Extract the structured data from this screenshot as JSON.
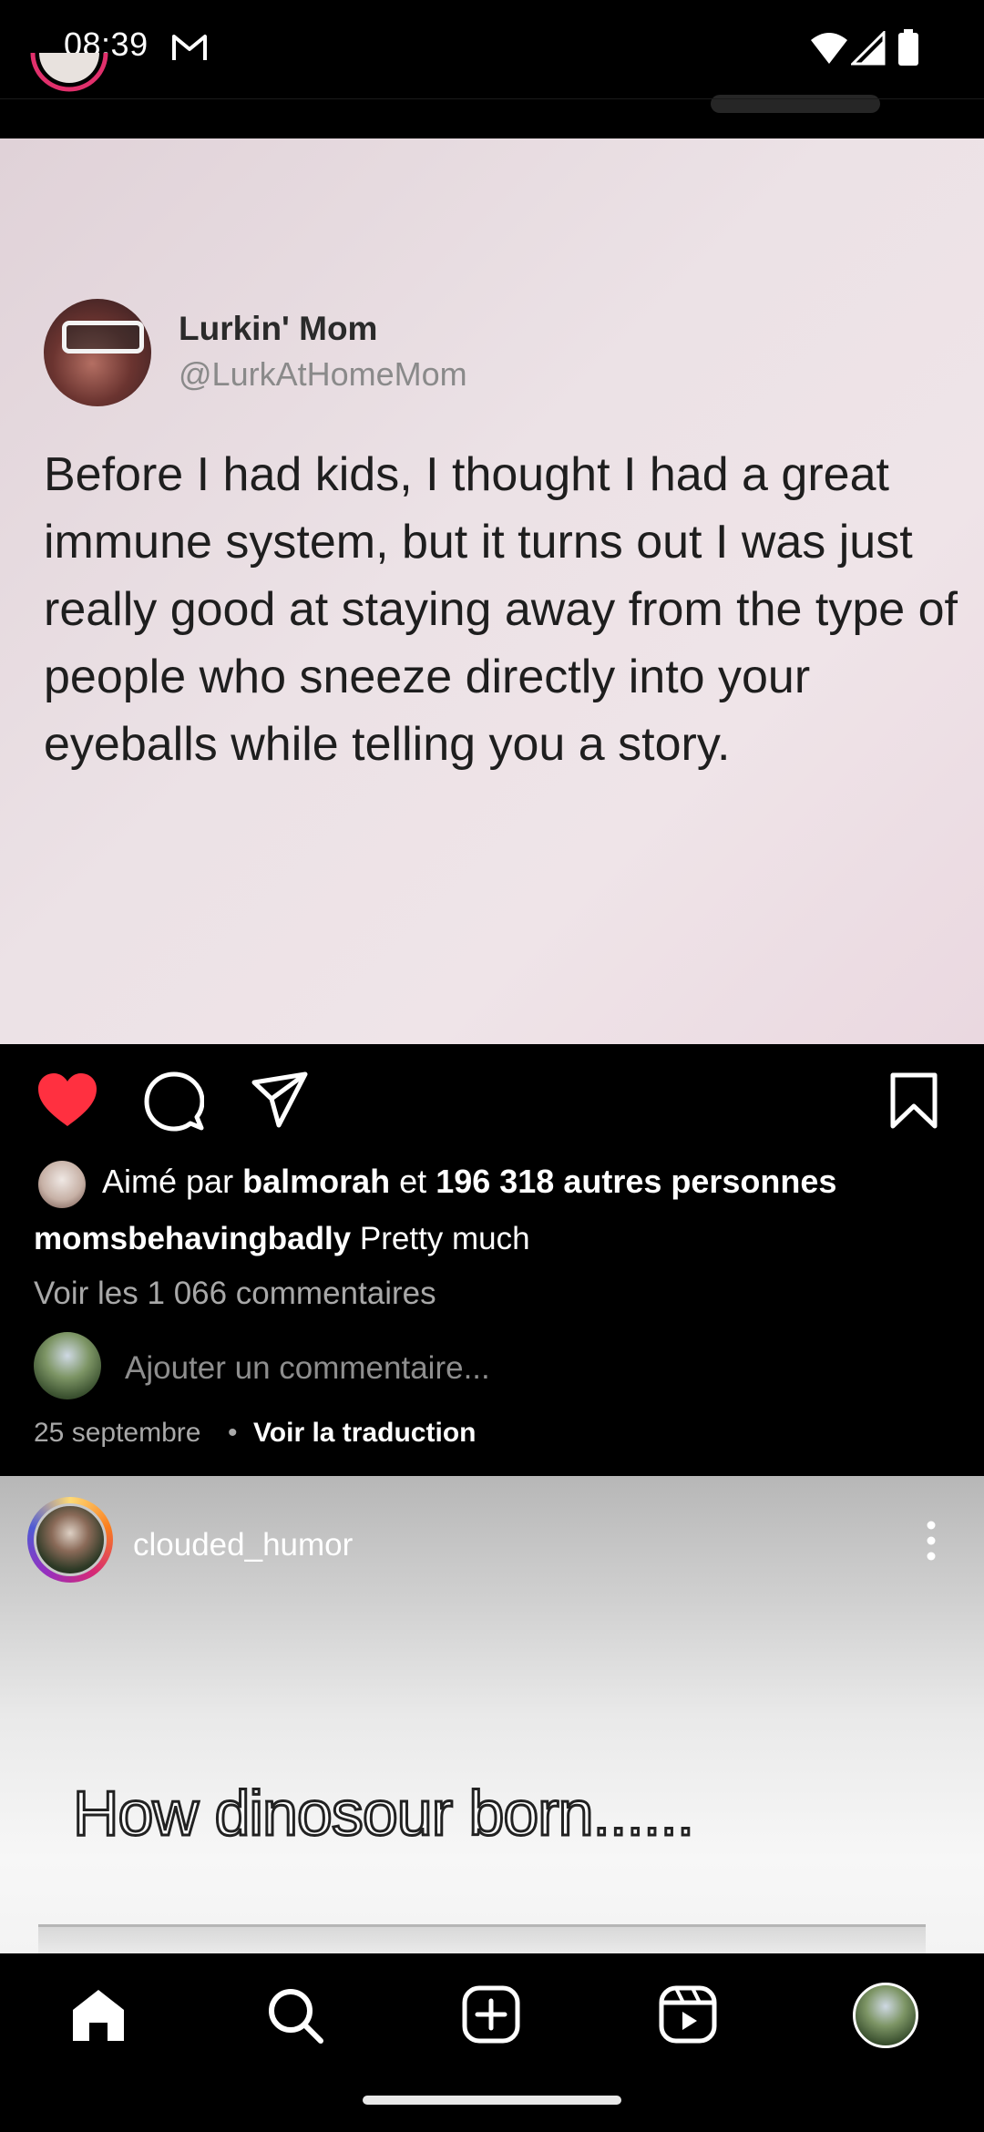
{
  "status_bar": {
    "time": "08:39"
  },
  "post1": {
    "tweet": {
      "name": "Lurkin' Mom",
      "handle": "@LurkAtHomeMom",
      "text": "Before I had kids, I thought I had a great immune system, but it turns out I was just really good at staying away from the type of people who sneeze directly into your eyeballs while telling you a story."
    },
    "likes": {
      "prefix": "Aimé par",
      "user": "balmorah",
      "connector": "et",
      "others": "196 318 autres personnes"
    },
    "caption": {
      "username": "momsbehavingbadly",
      "text": "Pretty much"
    },
    "view_comments": "Voir les 1 066 commentaires",
    "add_comment_placeholder": "Ajouter un commentaire...",
    "date": "25 septembre",
    "separator": "•",
    "translate_link": "Voir la traduction",
    "liked": true
  },
  "post2": {
    "username": "clouded_humor",
    "meme_text": "How dinosour born......"
  },
  "colors": {
    "like_red": "#ff3040",
    "background": "#000000",
    "secondary_text": "#a8a8a8"
  },
  "icons": {
    "status": [
      "gmail-icon",
      "wifi-icon",
      "signal-icon",
      "battery-icon"
    ],
    "actions": [
      "heart-icon",
      "comment-icon",
      "share-icon",
      "bookmark-icon"
    ],
    "nav": [
      "home-icon",
      "search-icon",
      "create-icon",
      "reels-icon",
      "profile-avatar"
    ]
  }
}
